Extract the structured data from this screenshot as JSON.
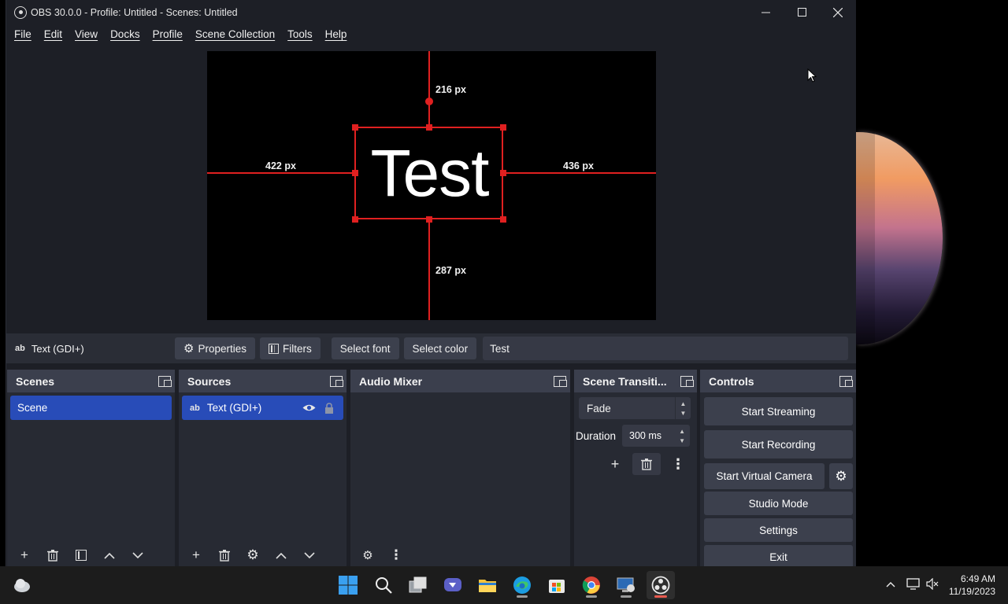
{
  "window": {
    "title": "OBS 30.0.0 - Profile: Untitled - Scenes: Untitled"
  },
  "menu": [
    "File",
    "Edit",
    "View",
    "Docks",
    "Profile",
    "Scene Collection",
    "Tools",
    "Help"
  ],
  "preview": {
    "text": "Test",
    "guide_top": "216 px",
    "guide_left": "422 px",
    "guide_right": "436 px",
    "guide_bottom": "287 px"
  },
  "source_toolbar": {
    "source_name": "Text (GDI+)",
    "source_icon": "ab",
    "properties": "Properties",
    "filters": "Filters",
    "select_font": "Select font",
    "select_color": "Select color",
    "text_value": "Test"
  },
  "docks": {
    "scenes": {
      "title": "Scenes",
      "items": [
        "Scene"
      ]
    },
    "sources": {
      "title": "Sources",
      "items": [
        "Text (GDI+)"
      ]
    },
    "audio_mixer": {
      "title": "Audio Mixer"
    },
    "transitions": {
      "title": "Scene Transiti...",
      "transition": "Fade",
      "duration_label": "Duration",
      "duration_value": "300 ms"
    },
    "controls": {
      "title": "Controls",
      "start_streaming": "Start Streaming",
      "start_recording": "Start Recording",
      "start_virtual_camera": "Start Virtual Camera",
      "studio_mode": "Studio Mode",
      "settings": "Settings",
      "exit": "Exit"
    }
  },
  "taskbar": {
    "time": "6:49 AM",
    "date": "11/19/2023"
  },
  "colors": {
    "selection_red": "#e02020",
    "list_selected": "#284cb8",
    "window_bg": "#1d1f26",
    "dock_bg": "#272a33"
  }
}
